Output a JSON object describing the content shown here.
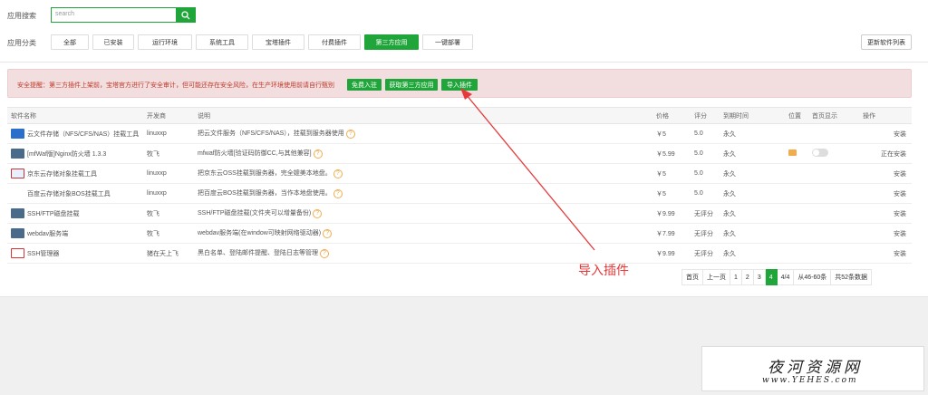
{
  "search": {
    "label": "应用搜索",
    "placeholder": "search"
  },
  "category": {
    "label": "应用分类",
    "tabs": [
      "全部",
      "已安装",
      "运行环境",
      "系统工具",
      "宝塔插件",
      "付费插件",
      "第三方应用",
      "一键部署"
    ],
    "active": "第三方应用",
    "refresh_label": "更新软件列表"
  },
  "alert": {
    "text": "安全提醒：第三方插件上架前，宝塔官方进行了安全审计，但可能还存在安全风险，在生产环境使用前请自行甄别",
    "buttons": [
      "免费入驻",
      "获取第三方应用",
      "导入插件"
    ]
  },
  "table": {
    "headers": [
      "软件名称",
      "开发商",
      "说明",
      "价格",
      "评分",
      "到期时间",
      "位置",
      "首页显示",
      "操作"
    ],
    "rows": [
      {
        "icon": "nfs-icon",
        "name": "云文件存储（NFS/CFS/NAS）挂载工具",
        "dev": "linuxxp",
        "desc": "把云文件服务（NFS/CFS/NAS），挂载到服务器使用",
        "price": "￥5",
        "score": "5.0",
        "expire": "永久",
        "op": "安装"
      },
      {
        "icon": "firewall-icon",
        "name": "[mfWaf版]Nginx防火墙 1.3.3",
        "dev": "牧飞",
        "desc": "mfwaf防火墙[验证码防御CC,与其他兼容]",
        "price": "￥5.99",
        "score": "5.0",
        "expire": "永久",
        "op": "正在安装"
      },
      {
        "icon": "jd-cloud-icon",
        "name": "京东云存储对象挂载工具",
        "dev": "linuxxp",
        "desc": "把京东云OSS挂载到服务器，完全媲美本地盘。",
        "price": "￥5",
        "score": "5.0",
        "expire": "永久",
        "op": "安装"
      },
      {
        "icon": "baidu-bos-icon",
        "name": "百度云存储对象BOS挂载工具",
        "dev": "linuxxp",
        "desc": "把百度云BOS挂载到服务器，当作本地盘使用。",
        "price": "￥5",
        "score": "5.0",
        "expire": "永久",
        "op": "安装"
      },
      {
        "icon": "ssh-ftp-icon",
        "name": "SSH/FTP磁盘挂载",
        "dev": "牧飞",
        "desc": "SSH/FTP磁盘挂载(文件夹可以增量备份)",
        "price": "￥9.99",
        "score": "无评分",
        "expire": "永久",
        "op": "安装"
      },
      {
        "icon": "webdav-icon",
        "name": "webdav服务端",
        "dev": "牧飞",
        "desc": "webdav服务端(在window可映射网络驱动器)",
        "price": "￥7.99",
        "score": "无评分",
        "expire": "永久",
        "op": "安装"
      },
      {
        "icon": "ssh-manager-icon",
        "name": "SSH管理器",
        "dev": "猪在天上飞",
        "desc": "黑白名单、登陆邮件提醒、登陆日志等管理",
        "price": "￥9.99",
        "score": "无评分",
        "expire": "永久",
        "op": "安装"
      }
    ]
  },
  "pager": {
    "items": [
      "首页",
      "上一页",
      "1",
      "2",
      "3",
      "4",
      "4/4",
      "从46-60条",
      "共52条数据"
    ],
    "current": "4"
  },
  "annotation": "导入插件",
  "watermark": {
    "title": "夜河资源网",
    "url": "www.YEHES.com"
  }
}
